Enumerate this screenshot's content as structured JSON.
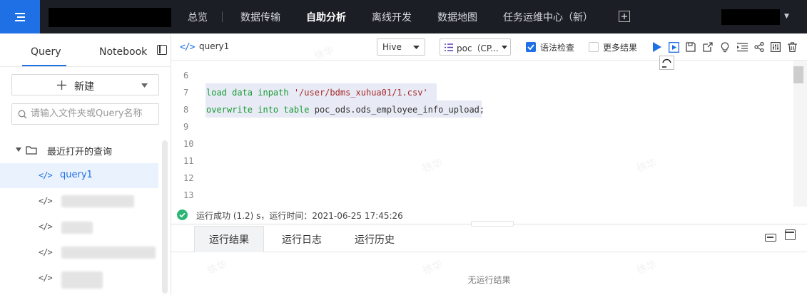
{
  "topbar": {
    "nav": [
      {
        "label": "总览",
        "active": false
      },
      {
        "label": "数据传输",
        "active": false
      },
      {
        "label": "自助分析",
        "active": true
      },
      {
        "label": "离线开发",
        "active": false
      },
      {
        "label": "数据地图",
        "active": false
      },
      {
        "label": "任务运维中心（新）",
        "active": false
      }
    ],
    "caret": "▼"
  },
  "sidebar": {
    "tabs": [
      "Query",
      "Notebook"
    ],
    "active_tab": "Query",
    "new_button": "新建",
    "search_placeholder": "请输入文件夹或Query名称",
    "folder": "最近打开的查询",
    "items": [
      {
        "label": "query1",
        "selected": true
      }
    ]
  },
  "toolbar": {
    "query_name": "query1",
    "engine": "Hive",
    "database": "poc（CP...",
    "syntax_check_label": "语法检查",
    "syntax_check": true,
    "more_results_label": "更多结果",
    "more_results": false
  },
  "editor": {
    "lines": [
      {
        "n": "6",
        "code": ""
      },
      {
        "n": "7",
        "code": "load data inpath '/user/bdms_xuhua01/1.csv'"
      },
      {
        "n": "8",
        "code": "overwrite into table poc_ods.ods_employee_info_upload;"
      },
      {
        "n": "9",
        "code": ""
      },
      {
        "n": "10",
        "code": ""
      },
      {
        "n": "11",
        "code": ""
      },
      {
        "n": "12",
        "code": ""
      },
      {
        "n": "13",
        "code": ""
      }
    ],
    "line7": {
      "kw": "load data inpath ",
      "str": "'/user/bdms_xuhua01/1.csv'"
    },
    "line8": {
      "kw": "overwrite into table ",
      "rest": "poc_ods.ods_employee_info_upload;"
    }
  },
  "status": {
    "text": "运行成功 (1.2) s，运行时间：2021-06-25 17:45:26"
  },
  "results": {
    "tabs": [
      "运行结果",
      "运行日志",
      "运行历史"
    ],
    "active_tab": "运行结果",
    "empty_text": "无运行结果"
  },
  "watermark": "徐华",
  "colors": {
    "accent": "#1f6fe5",
    "topbar": "#1b1e25",
    "success": "#2bb673"
  }
}
